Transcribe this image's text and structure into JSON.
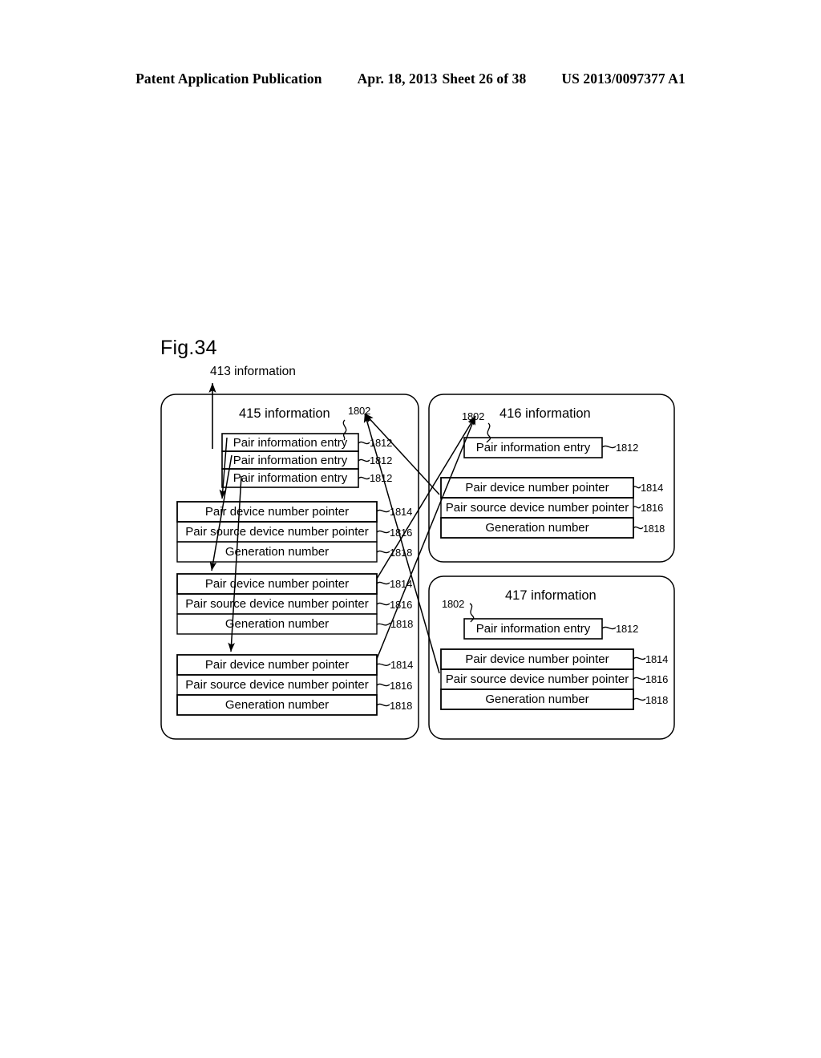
{
  "header": {
    "publication": "Patent Application Publication",
    "date": "Apr. 18, 2013",
    "sheet": "Sheet 26 of 38",
    "patent_number": "US 2013/0097377 A1"
  },
  "figure": {
    "label": "Fig.34",
    "top_caption": "413 information"
  },
  "labels": {
    "entry": "Pair information entry",
    "device_ptr": "Pair device number pointer",
    "source_ptr": "Pair source device number pointer",
    "generation": "Generation number",
    "ref_1802": "1802",
    "ref_1812": "1812",
    "ref_1814": "1814",
    "ref_1816": "1816",
    "ref_1818": "1818"
  },
  "panels": {
    "left": {
      "title": "415 information",
      "pointer_label": "1802",
      "entries": [
        {
          "text": "Pair information entry",
          "ref": "1812"
        },
        {
          "text": "Pair information entry",
          "ref": "1812"
        },
        {
          "text": "Pair information entry",
          "ref": "1812"
        }
      ],
      "groups": [
        {
          "rows": [
            {
              "text": "Pair device number pointer",
              "ref": "1814"
            },
            {
              "text": "Pair source device number pointer",
              "ref": "1816"
            },
            {
              "text": "Generation number",
              "ref": "1818"
            }
          ]
        },
        {
          "rows": [
            {
              "text": "Pair device number pointer",
              "ref": "1814"
            },
            {
              "text": "Pair source device number pointer",
              "ref": "1816"
            },
            {
              "text": "Generation number",
              "ref": "1818"
            }
          ]
        },
        {
          "rows": [
            {
              "text": "Pair device number pointer",
              "ref": "1814"
            },
            {
              "text": "Pair source device number pointer",
              "ref": "1816"
            },
            {
              "text": "Generation number",
              "ref": "1818"
            }
          ]
        }
      ]
    },
    "right_top": {
      "title": "416 information",
      "pointer_label": "1802",
      "entries": [
        {
          "text": "Pair information entry",
          "ref": "1812"
        }
      ],
      "groups": [
        {
          "rows": [
            {
              "text": "Pair device number pointer",
              "ref": "1814"
            },
            {
              "text": "Pair source device number pointer",
              "ref": "1816"
            },
            {
              "text": "Generation number",
              "ref": "1818"
            }
          ]
        }
      ]
    },
    "right_bottom": {
      "title": "417 information",
      "pointer_label": "1802",
      "entries": [
        {
          "text": "Pair information entry",
          "ref": "1812"
        }
      ],
      "groups": [
        {
          "rows": [
            {
              "text": "Pair device number pointer",
              "ref": "1814"
            },
            {
              "text": "Pair source device number pointer",
              "ref": "1816"
            },
            {
              "text": "Generation number",
              "ref": "1818"
            }
          ]
        }
      ]
    }
  },
  "colors": {
    "ink": "#000000",
    "page": "#ffffff"
  }
}
